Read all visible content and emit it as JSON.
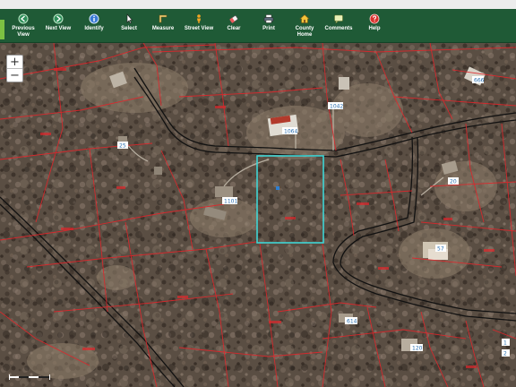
{
  "toolbar": {
    "tools": [
      {
        "id": "previous-view",
        "label": "Previous\nView",
        "icon": "previous-view-icon"
      },
      {
        "id": "next-view",
        "label": "Next View",
        "icon": "next-view-icon"
      },
      {
        "id": "identify",
        "label": "Identify",
        "icon": "identify-icon"
      },
      {
        "id": "select",
        "label": "Select",
        "icon": "select-pointer-icon"
      },
      {
        "id": "measure",
        "label": "Measure",
        "icon": "measure-icon"
      },
      {
        "id": "street-view",
        "label": "Street View",
        "icon": "street-view-icon"
      },
      {
        "id": "clear",
        "label": "Clear",
        "icon": "clear-icon"
      },
      {
        "id": "print",
        "label": "Print",
        "icon": "print-icon"
      },
      {
        "id": "county-home",
        "label": "County\nHome",
        "icon": "home-icon"
      },
      {
        "id": "comments",
        "label": "Comments",
        "icon": "comments-icon"
      },
      {
        "id": "help",
        "label": "Help",
        "icon": "help-icon"
      }
    ]
  },
  "map": {
    "zoom_in_label": "+",
    "zoom_out_label": "−",
    "address_labels": [
      "25",
      "1101",
      "1064",
      "1042",
      "666",
      "20",
      "57",
      "614",
      "120",
      "1",
      "2"
    ],
    "colors": {
      "toolbar_bg": "#1f5a36",
      "parcel_line": "#e0262b",
      "selected_parcel": "#3fd6d6",
      "road_line": "#111111",
      "address_label_bg": "#ffffff",
      "address_label_text": "#2a6fb0"
    }
  }
}
